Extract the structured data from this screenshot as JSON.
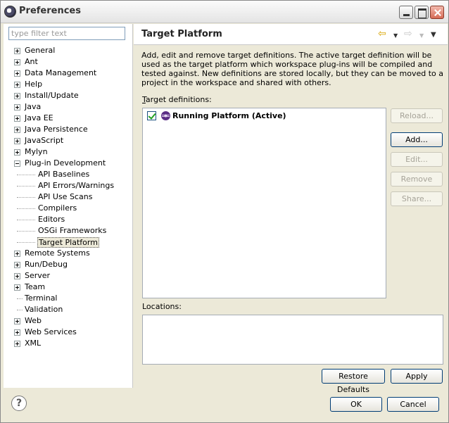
{
  "window": {
    "title": "Preferences"
  },
  "filter": {
    "placeholder": "type filter text"
  },
  "tree": {
    "general": "General",
    "ant": "Ant",
    "data_management": "Data Management",
    "help": "Help",
    "install_update": "Install/Update",
    "java": "Java",
    "java_ee": "Java EE",
    "java_persistence": "Java Persistence",
    "javascript": "JavaScript",
    "mylyn": "Mylyn",
    "plugin_development": "Plug-in Development",
    "api_baselines": "API Baselines",
    "api_errors": "API Errors/Warnings",
    "api_use_scans": "API Use Scans",
    "compilers": "Compilers",
    "editors": "Editors",
    "osgi_frameworks": "OSGi Frameworks",
    "target_platform": "Target Platform",
    "remote_systems": "Remote Systems",
    "run_debug": "Run/Debug",
    "server": "Server",
    "team": "Team",
    "terminal": "Terminal",
    "validation": "Validation",
    "web": "Web",
    "web_services": "Web Services",
    "xml": "XML"
  },
  "page": {
    "title": "Target Platform",
    "description": "Add, edit and remove target definitions.  The active target definition will be used as the target platform which workspace plug-ins will be compiled and tested against.  New definitions are stored locally, but they can be moved to a project in the workspace and shared with others.",
    "target_definitions_label": "Target definitions:",
    "target_definitions_accel": "T",
    "target_definitions_rest": "arget definitions:",
    "target_entry": "Running Platform (Active)",
    "locations_label": "Locations:"
  },
  "buttons": {
    "reload": "Reload...",
    "add": "Add...",
    "edit": "Edit...",
    "remove": "Remove",
    "share": "Share...",
    "restore_defaults": "Restore Defaults",
    "apply": "Apply",
    "ok": "OK",
    "cancel": "Cancel"
  },
  "icons": {
    "help": "?",
    "back": "⇦",
    "forward": "⇨",
    "dropdown": "▼"
  }
}
